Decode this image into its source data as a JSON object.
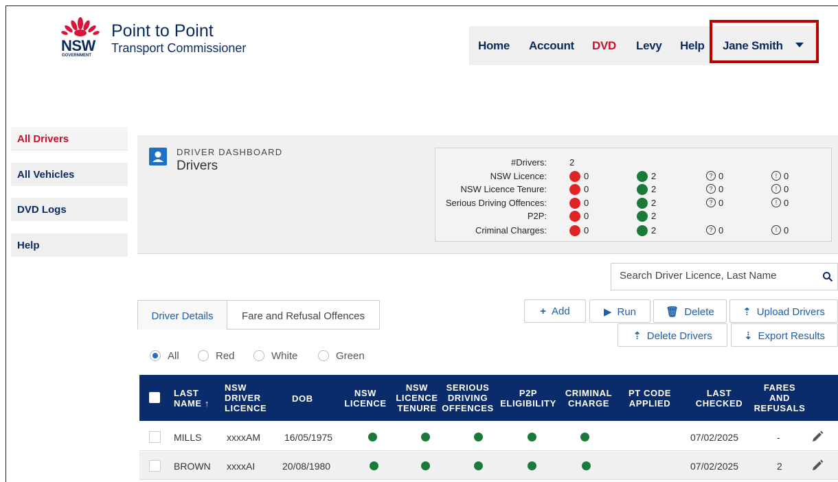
{
  "brand": {
    "logo_text": "NSW",
    "logo_sub": "GOVERNMENT",
    "title": "Point to Point",
    "subtitle": "Transport Commissioner"
  },
  "topnav": {
    "items": [
      {
        "label": "Home",
        "active": false
      },
      {
        "label": "Account",
        "active": false
      },
      {
        "label": "DVD",
        "active": true
      },
      {
        "label": "Levy",
        "active": false
      },
      {
        "label": "Help",
        "active": false
      }
    ],
    "user": "Jane Smith"
  },
  "sidebar": {
    "items": [
      {
        "label": "All Drivers",
        "active": true
      },
      {
        "label": "All Vehicles",
        "active": false
      },
      {
        "label": "DVD Logs",
        "active": false
      },
      {
        "label": "Help",
        "active": false
      }
    ]
  },
  "dashboard": {
    "eyebrow": "DRIVER DASHBOARD",
    "title": "Drivers",
    "drivers_label": "#Drivers:",
    "drivers_count": "2",
    "rows": [
      {
        "label": "NSW Licence:",
        "red": "0",
        "green": "2",
        "unknown": "0",
        "info": "0"
      },
      {
        "label": "NSW Licence Tenure:",
        "red": "0",
        "green": "2",
        "unknown": "0",
        "info": "0"
      },
      {
        "label": "Serious Driving Offences:",
        "red": "0",
        "green": "2",
        "unknown": "0",
        "info": "0"
      },
      {
        "label": "P2P:",
        "red": "0",
        "green": "2",
        "unknown": "",
        "info": ""
      },
      {
        "label": "Criminal Charges:",
        "red": "0",
        "green": "2",
        "unknown": "0",
        "info": "0"
      }
    ],
    "colors": {
      "red": "#e02424",
      "green": "#1a7a3a"
    }
  },
  "search": {
    "placeholder": "Search Driver Licence, Last Name",
    "value": ""
  },
  "tabs": [
    {
      "label": "Driver Details",
      "active": true
    },
    {
      "label": "Fare and Refusal Offences",
      "active": false
    }
  ],
  "actions": {
    "add": "Add",
    "run": "Run",
    "delete": "Delete",
    "upload": "Upload Drivers",
    "delete_drivers": "Delete Drivers",
    "export": "Export Results"
  },
  "filters": {
    "options": [
      "All",
      "Red",
      "White",
      "Green"
    ],
    "selected": "All"
  },
  "table": {
    "headers": {
      "last_name_1": "LAST",
      "last_name_2": "NAME ↑",
      "licence_1": "NSW",
      "licence_2": "DRIVER",
      "licence_3": "LICENCE",
      "dob": "DOB",
      "nsw_licence_1": "NSW",
      "nsw_licence_2": "LICENCE",
      "tenure_1": "NSW",
      "tenure_2": "LICENCE",
      "tenure_3": "TENURE",
      "serious_1": "SERIOUS",
      "serious_2": "DRIVING",
      "serious_3": "OFFENCES",
      "p2p_1": "P2P",
      "p2p_2": "ELIGIBILITY",
      "criminal_1": "CRIMINAL",
      "criminal_2": "CHARGE",
      "pt_1": "PT CODE",
      "pt_2": "APPLIED",
      "checked_1": "LAST",
      "checked_2": "CHECKED",
      "fares_1": "FARES",
      "fares_2": "AND",
      "fares_3": "REFUSALS"
    },
    "rows": [
      {
        "last_name": "MILLS",
        "licence": "xxxxAM",
        "dob": "16/05/1975",
        "nsw_licence": "green",
        "tenure": "green",
        "serious": "green",
        "p2p": "green",
        "criminal": "green",
        "pt_code": "",
        "last_checked": "07/02/2025",
        "fares": "-"
      },
      {
        "last_name": "BROWN",
        "licence": "xxxxAI",
        "dob": "20/08/1980",
        "nsw_licence": "green",
        "tenure": "green",
        "serious": "green",
        "p2p": "green",
        "criminal": "green",
        "pt_code": "",
        "last_checked": "07/02/2025",
        "fares": "2"
      }
    ]
  }
}
